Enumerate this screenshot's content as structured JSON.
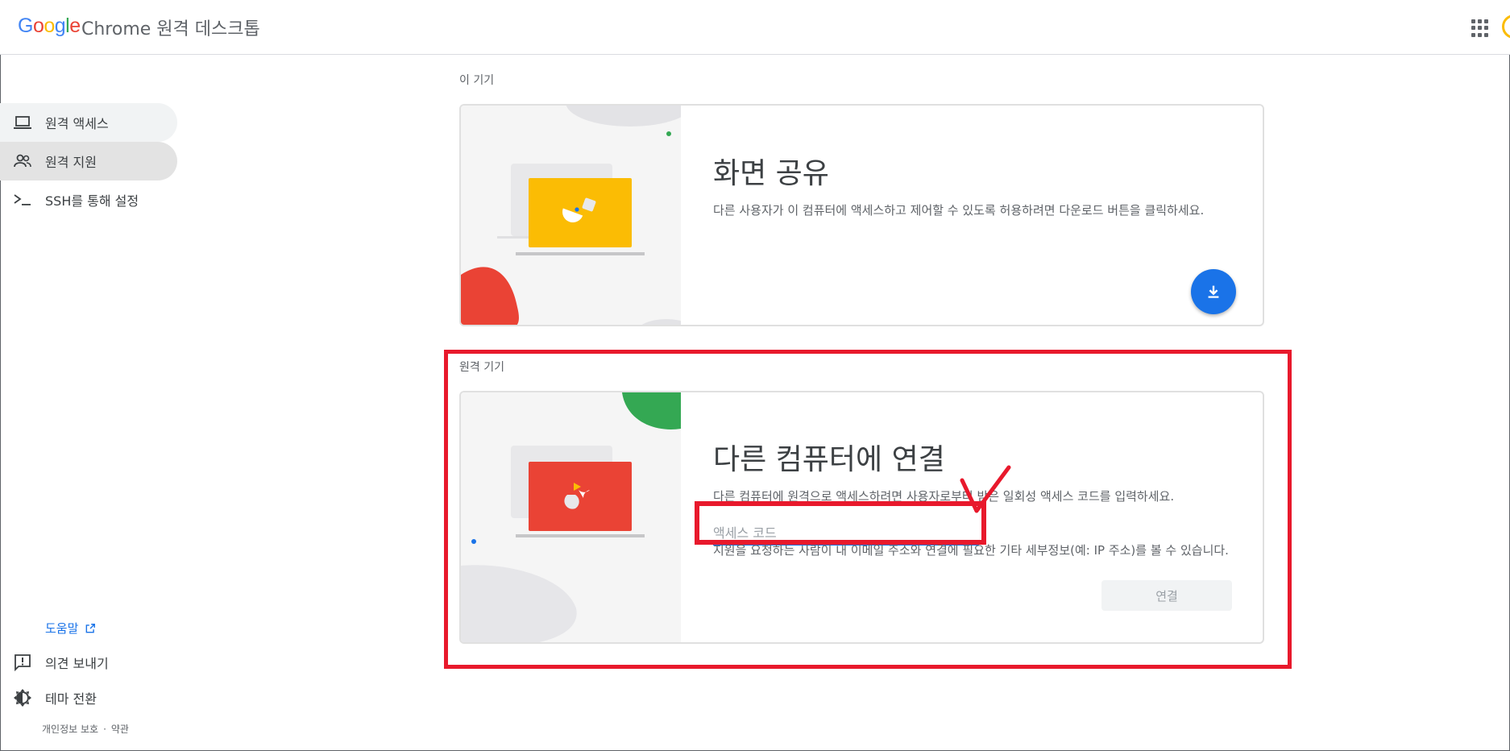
{
  "header": {
    "logo_letters": [
      "G",
      "o",
      "o",
      "g",
      "l",
      "e"
    ],
    "app_title": "Chrome 원격 데스크톱"
  },
  "sidebar": {
    "items": [
      {
        "label": "원격 액세스",
        "icon": "laptop-icon"
      },
      {
        "label": "원격 지원",
        "icon": "people-icon"
      },
      {
        "label": "SSH를 통해 설정",
        "icon": "terminal-icon"
      }
    ],
    "help_label": "도움말",
    "feedback_label": "의견 보내기",
    "theme_label": "테마 전환",
    "privacy_label": "개인정보 보호",
    "separator": "·",
    "terms_label": "약관"
  },
  "this_device": {
    "section_title": "이 기기",
    "heading": "화면 공유",
    "description": "다른 사용자가 이 컴퓨터에 액세스하고 제어할 수 있도록 허용하려면 다운로드 버튼을 클릭하세요."
  },
  "remote_device": {
    "section_title": "원격 기기",
    "heading": "다른 컴퓨터에 연결",
    "description": "다른 컴퓨터에 원격으로 액세스하려면 사용자로부터 받은 일회성 액세스 코드를 입력하세요.",
    "input_placeholder": "액세스 코드",
    "disclaimer": "지원을 요청하는 사람이 내 이메일 주소와 연결에 필요한 기타 세부정보(예: IP 주소)를 볼 수 있습니다.",
    "connect_label": "연결"
  },
  "colors": {
    "accent": "#1a73e8",
    "annotation": "#e8192c",
    "screen_yellow": "#fbbc04",
    "screen_red": "#ea4335",
    "blob_green": "#34a853"
  }
}
